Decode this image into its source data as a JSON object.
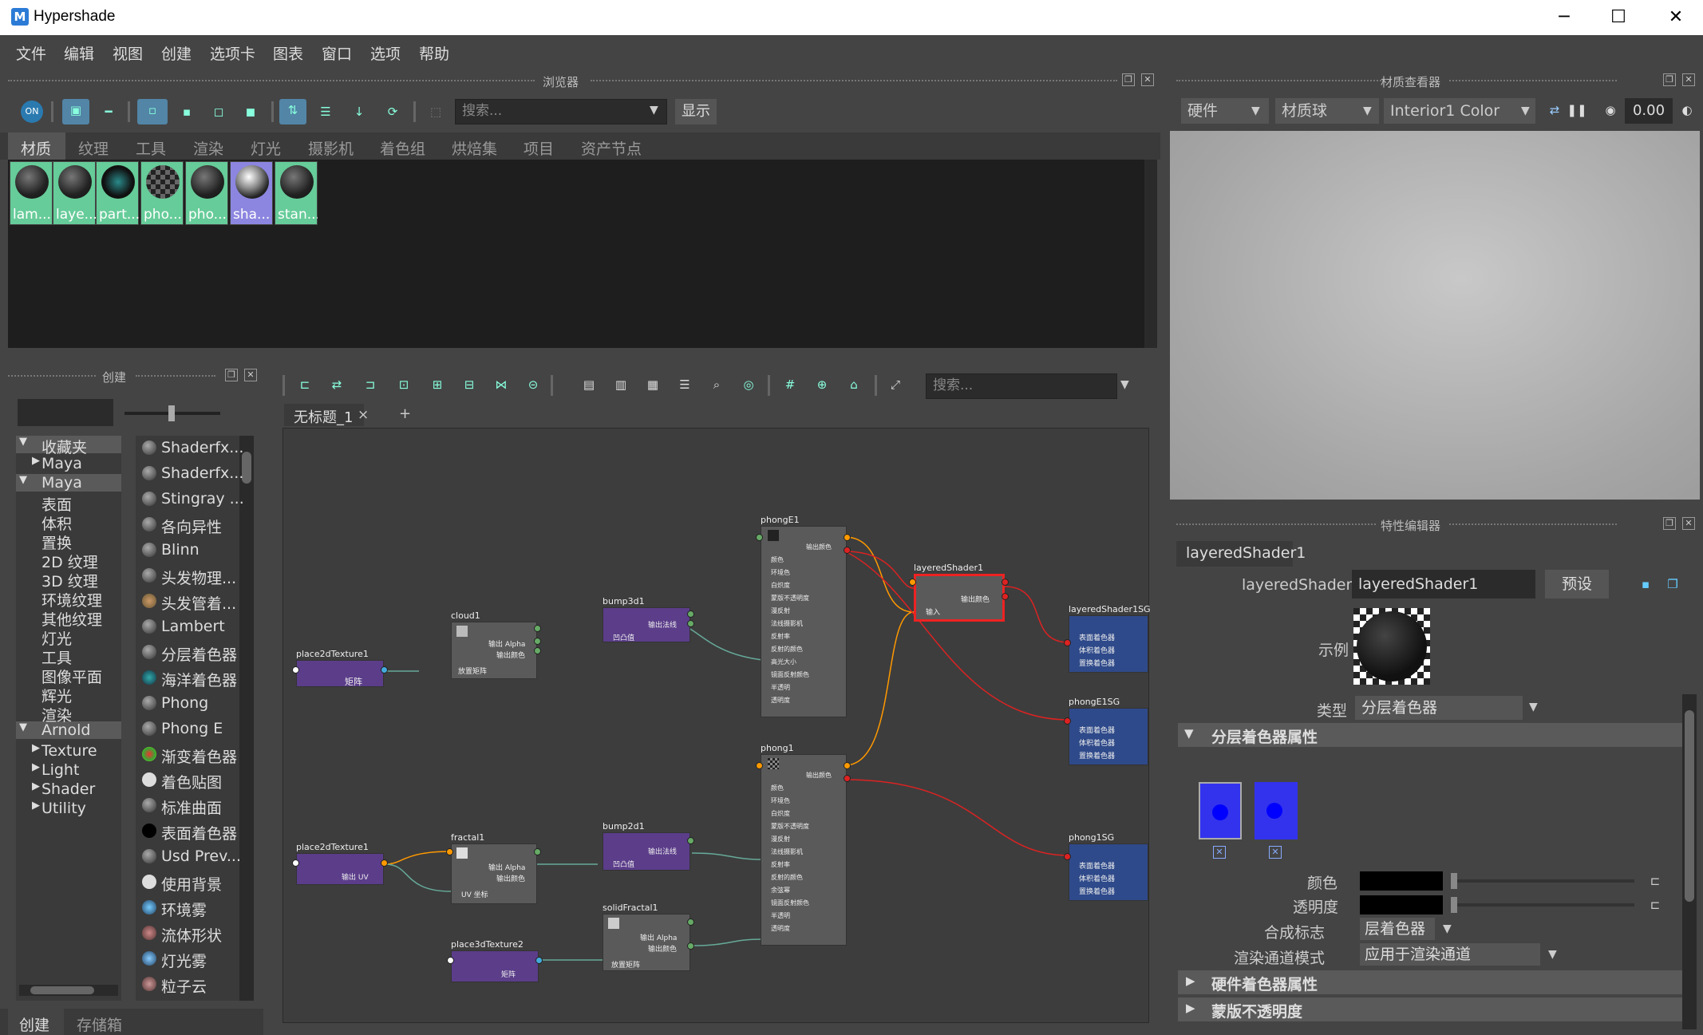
{
  "window": {
    "title": "Hypershade",
    "logo": "M",
    "minimize": "─",
    "maximize": "☐",
    "close": "✕"
  },
  "menu": [
    "文件",
    "编辑",
    "视图",
    "创建",
    "选项卡",
    "图表",
    "窗口",
    "选项",
    "帮助"
  ],
  "browser": {
    "header": "浏览器",
    "search_placeholder": "搜索...",
    "show_button": "显示",
    "tabs": [
      "材质",
      "纹理",
      "工具",
      "渲染",
      "灯光",
      "摄影机",
      "着色组",
      "烘焙集",
      "项目",
      "资产节点"
    ],
    "swatches": [
      {
        "label": "lam...",
        "color": "#6c9"
      },
      {
        "label": "laye...",
        "color": "#6c9"
      },
      {
        "label": "part...",
        "color": "#6c9"
      },
      {
        "label": "pho...",
        "color": "#6c9"
      },
      {
        "label": "pho...",
        "color": "#6c9"
      },
      {
        "label": "sha...",
        "color": "#8c86e0"
      },
      {
        "label": "stan...",
        "color": "#6c9"
      }
    ]
  },
  "material_viewer": {
    "header": "材质查看器",
    "renderer": "硬件",
    "shape": "材质球",
    "environment": "Interior1 Color",
    "exposure": "0.00"
  },
  "create_panel": {
    "header": "创建",
    "tree": [
      {
        "label": "收藏夹",
        "level": 0,
        "expanded": true,
        "selected": true
      },
      {
        "label": "Maya",
        "level": 1,
        "expanded": false
      },
      {
        "label": "Maya",
        "level": 0,
        "expanded": true,
        "selected": true
      },
      {
        "label": "表面",
        "level": 2
      },
      {
        "label": "体积",
        "level": 2
      },
      {
        "label": "置换",
        "level": 2
      },
      {
        "label": "2D 纹理",
        "level": 2
      },
      {
        "label": "3D 纹理",
        "level": 2
      },
      {
        "label": "环境纹理",
        "level": 2
      },
      {
        "label": "其他纹理",
        "level": 2
      },
      {
        "label": "灯光",
        "level": 2
      },
      {
        "label": "工具",
        "level": 2
      },
      {
        "label": "图像平面",
        "level": 2
      },
      {
        "label": "辉光",
        "level": 2
      },
      {
        "label": "渲染",
        "level": 2
      },
      {
        "label": "Arnold",
        "level": 0,
        "expanded": true,
        "selected": true
      },
      {
        "label": "Texture",
        "level": 1
      },
      {
        "label": "Light",
        "level": 1
      },
      {
        "label": "Shader",
        "level": 1
      },
      {
        "label": "Utility",
        "level": 1
      }
    ],
    "nodes": [
      "Shaderfx...",
      "Shaderfx...",
      "Stingray ...",
      "各向异性",
      "Blinn",
      "头发物理...",
      "头发管着...",
      "Lambert",
      "分层着色器",
      "海洋着色器",
      "Phong",
      "Phong E",
      "渐变着色器",
      "着色贴图",
      "标准曲面",
      "表面着色器",
      "Usd Prev...",
      "使用背景",
      "环境雾",
      "流体形状",
      "灯光雾",
      "粒子云"
    ],
    "bottom_tabs": [
      "创建",
      "存储箱"
    ]
  },
  "graph": {
    "search_placeholder": "搜索...",
    "tab": "无标题_1",
    "tab_close": "×",
    "add_tab": "+",
    "nodes": {
      "place2dTexture1": {
        "title": "place2dTexture1",
        "ports": [
          "矩阵"
        ]
      },
      "cloud1": {
        "title": "cloud1",
        "ports": [
          "输出 Alpha",
          "输出颜色",
          "放置矩阵"
        ]
      },
      "bump3d1": {
        "title": "bump3d1",
        "ports": [
          "输出法线",
          "凹凸值"
        ]
      },
      "phongE1": {
        "title": "phongE1",
        "ports": [
          "输出颜色",
          "颜色",
          "环境色",
          "白炽度",
          "蒙版不透明度",
          "漫反射",
          "法线摄影机",
          "反射率",
          "反射的颜色",
          "高光大小",
          "镜面反射颜色",
          "半透明",
          "透明度"
        ]
      },
      "layeredShader1": {
        "title": "layeredShader1",
        "ports": [
          "输出颜色",
          "输入"
        ]
      },
      "layeredShader1SG": {
        "title": "layeredShader1SG",
        "ports": [
          "表面着色器",
          "体积着色器",
          "置换着色器"
        ]
      },
      "phongE1SG": {
        "title": "phongE1SG",
        "ports": [
          "表面着色器",
          "体积着色器",
          "置换着色器"
        ]
      },
      "phong1": {
        "title": "phong1",
        "ports": [
          "输出颜色",
          "颜色",
          "环境色",
          "白炽度",
          "蒙版不透明度",
          "漫反射",
          "法线摄影机",
          "反射率",
          "反射的颜色",
          "余弦幂",
          "镜面反射颜色",
          "半透明",
          "透明度"
        ]
      },
      "phong1SG": {
        "title": "phong1SG",
        "ports": [
          "表面着色器",
          "体积着色器",
          "置换着色器"
        ]
      },
      "place2dTexture1b": {
        "title": "place2dTexture1",
        "ports": [
          "输出 UV"
        ]
      },
      "fractal1": {
        "title": "fractal1",
        "ports": [
          "输出 Alpha",
          "输出颜色",
          "UV 坐标"
        ]
      },
      "bump2d1": {
        "title": "bump2d1",
        "ports": [
          "输出法线",
          "凹凸值"
        ]
      },
      "solidFractal1": {
        "title": "solidFractal1",
        "ports": [
          "输出 Alpha",
          "输出颜色",
          "放置矩阵"
        ]
      },
      "place3dTexture2": {
        "title": "place3dTexture2",
        "ports": [
          "矩阵"
        ]
      }
    }
  },
  "attribute_editor": {
    "header": "特性编辑器",
    "tab": "layeredShader1",
    "node_label": "layeredShader:",
    "node_name": "layeredShader1",
    "presets_button": "预设",
    "sample_label": "示例",
    "type_label": "类型",
    "type_value": "分层着色器",
    "section_layered": "分层着色器属性",
    "color_label": "颜色",
    "transparency_label": "透明度",
    "composite_label": "合成标志",
    "composite_value": "层着色器",
    "render_pass_label": "渲染通道模式",
    "render_pass_value": "应用于渲染通道",
    "section_hardware": "硬件着色器属性",
    "section_matte": "蒙版不透明度",
    "layer_color": "#0000ff"
  }
}
